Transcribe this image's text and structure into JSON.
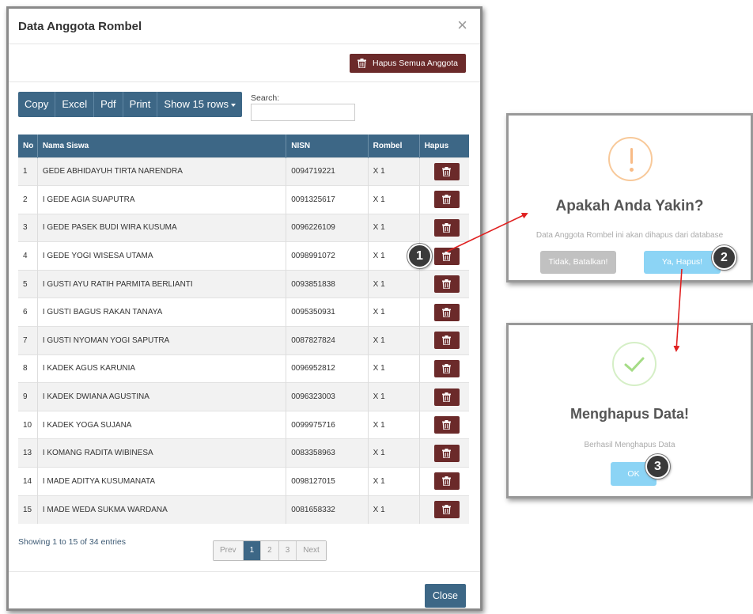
{
  "modal": {
    "title": "Data Anggota Rombel",
    "close_glyph": "×",
    "delete_all_label": "Hapus Semua Anggota",
    "toolbar": {
      "copy": "Copy",
      "excel": "Excel",
      "pdf": "Pdf",
      "print": "Print",
      "show_rows": "Show 15 rows"
    },
    "search": {
      "label": "Search:",
      "value": ""
    },
    "table": {
      "headers": [
        "No",
        "Nama Siswa",
        "NISN",
        "Rombel",
        "Hapus"
      ],
      "rows": [
        {
          "no": "1",
          "nama": "GEDE ABHIDAYUH TIRTA NARENDRA",
          "nisn": "0094719221",
          "rombel": "X 1"
        },
        {
          "no": "2",
          "nama": "I GEDE AGIA SUAPUTRA",
          "nisn": "0091325617",
          "rombel": "X 1"
        },
        {
          "no": "3",
          "nama": "I GEDE PASEK BUDI WIRA KUSUMA",
          "nisn": "0096226109",
          "rombel": "X 1"
        },
        {
          "no": "4",
          "nama": "I GEDE YOGI WISESA UTAMA",
          "nisn": "0098991072",
          "rombel": "X 1"
        },
        {
          "no": "5",
          "nama": "I GUSTI AYU RATIH PARMITA BERLIANTI",
          "nisn": "0093851838",
          "rombel": "X 1"
        },
        {
          "no": "6",
          "nama": "I GUSTI BAGUS RAKAN TANAYA",
          "nisn": "0095350931",
          "rombel": "X 1"
        },
        {
          "no": "7",
          "nama": "I GUSTI NYOMAN YOGI SAPUTRA",
          "nisn": "0087827824",
          "rombel": "X 1"
        },
        {
          "no": "8",
          "nama": "I KADEK AGUS KARUNIA",
          "nisn": "0096952812",
          "rombel": "X 1"
        },
        {
          "no": "9",
          "nama": "I KADEK DWIANA AGUSTINA",
          "nisn": "0096323003",
          "rombel": "X 1"
        },
        {
          "no": "10",
          "nama": "I KADEK YOGA SUJANA",
          "nisn": "0099975716",
          "rombel": "X 1"
        },
        {
          "no": "13",
          "nama": "I KOMANG RADITA WIBINESA",
          "nisn": "0083358963",
          "rombel": "X 1"
        },
        {
          "no": "14",
          "nama": "I MADE ADITYA KUSUMANATA",
          "nisn": "0098127015",
          "rombel": "X 1"
        },
        {
          "no": "15",
          "nama": "I MADE WEDA SUKMA WARDANA",
          "nisn": "0081658332",
          "rombel": "X 1"
        }
      ]
    },
    "info": "Showing 1 to 15 of 34 entries",
    "pagination": {
      "prev": "Prev",
      "pages": [
        "1",
        "2",
        "3"
      ],
      "current": "1",
      "next": "Next"
    },
    "close_label": "Close"
  },
  "confirm_dialog": {
    "icon": "warning-icon",
    "title": "Apakah Anda Yakin?",
    "text": "Data Anggota Rombel ini akan dihapus dari database",
    "cancel_label": "Tidak, Batalkan!",
    "confirm_label": "Ya, Hapus!"
  },
  "success_dialog": {
    "icon": "check-icon",
    "title": "Menghapus Data!",
    "text": "Berhasil Menghapus Data",
    "ok_label": "OK"
  },
  "markers": [
    "1",
    "2",
    "3"
  ],
  "colors": {
    "primary": "#3d6786",
    "danger": "#6b2a2a",
    "sweetalert_button": "#8cd4f5",
    "cancel_button": "#c1c1c1",
    "warning": "#f8bb86",
    "success": "#a5dc86",
    "arrow": "#e02020"
  }
}
